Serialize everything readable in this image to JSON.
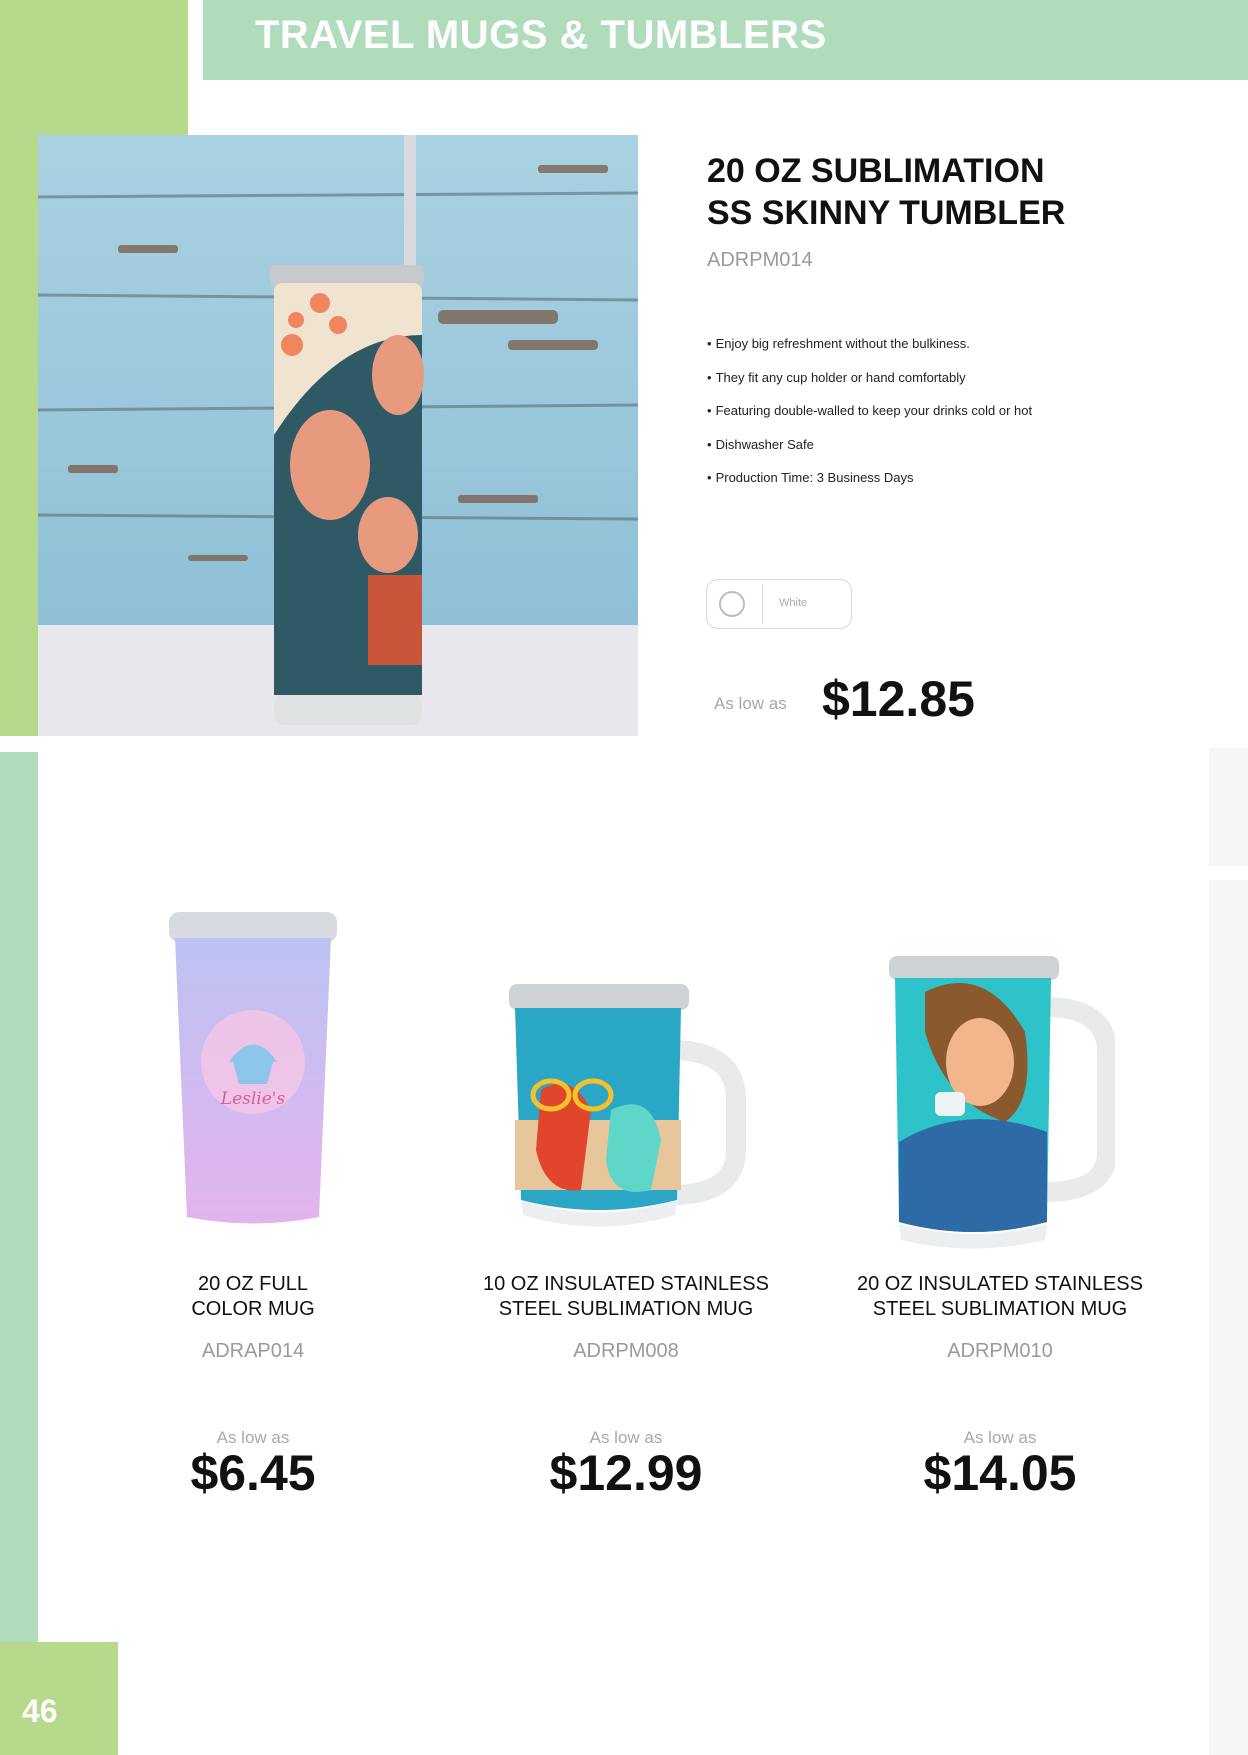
{
  "header": {
    "title": "TRAVEL MUGS & TUMBLERS"
  },
  "featured": {
    "name_line1": "20 OZ SUBLIMATION",
    "name_line2": "SS SKINNY TUMBLER",
    "sku": "ADRPM014",
    "bullets": [
      "Enjoy big refreshment without the bulkiness.",
      "They fit any cup holder or hand comfortably",
      "Featuring double-walled to keep your drinks cold or hot",
      "Dishwasher Safe",
      "Production Time: 3 Business Days"
    ],
    "bullet_symbol": "•",
    "color_option": {
      "label": "White",
      "swatch_color": "#ffffff"
    },
    "price_prefix": "As low as",
    "price": "$12.85"
  },
  "products": [
    {
      "name_line1": "20 OZ FULL",
      "name_line2": "COLOR MUG",
      "sku": "ADRAP014",
      "price_prefix": "As low as",
      "price": "$6.45",
      "logo_text": "Leslie's"
    },
    {
      "name_line1": "10 OZ INSULATED STAINLESS",
      "name_line2": "STEEL SUBLIMATION MUG",
      "sku": "ADRPM008",
      "price_prefix": "As low as",
      "price": "$12.99"
    },
    {
      "name_line1": "20 OZ INSULATED STAINLESS",
      "name_line2": "STEEL SUBLIMATION MUG",
      "sku": "ADRPM010",
      "price_prefix": "As low as",
      "price": "$14.05"
    }
  ],
  "page_number": "46",
  "colors": {
    "header_green": "#b1dcbb",
    "accent_lime": "#b6d98c",
    "muted_text": "#9a9a9a"
  }
}
